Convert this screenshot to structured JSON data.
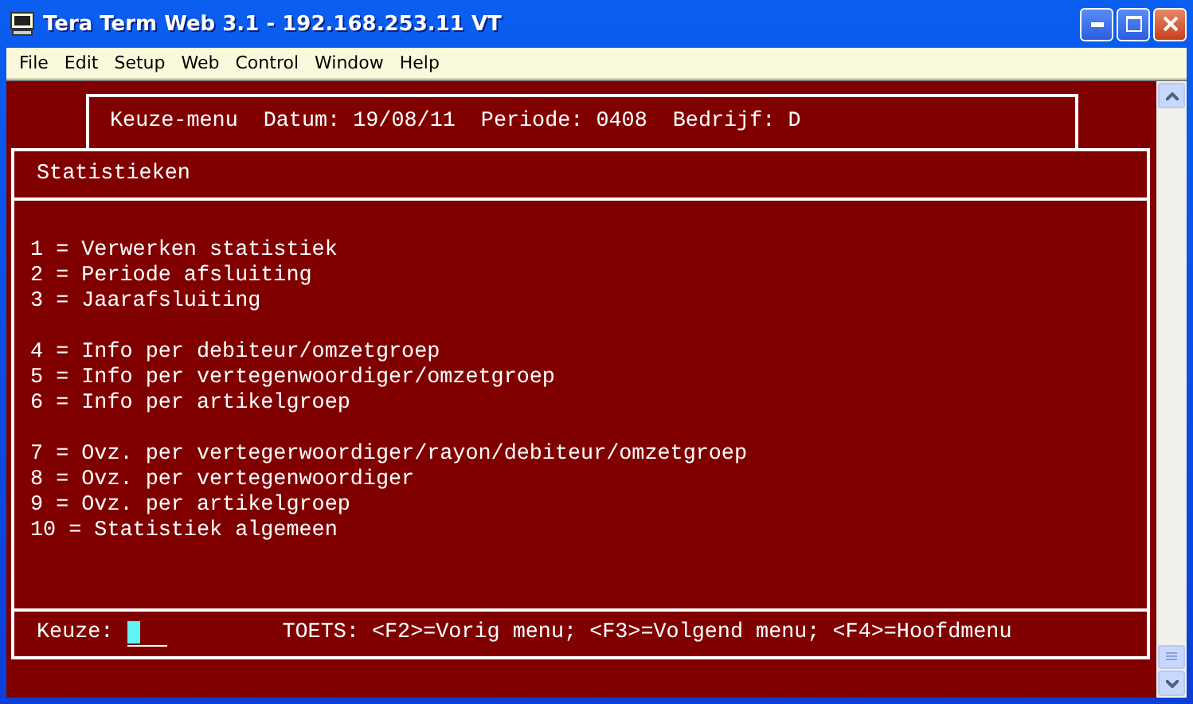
{
  "window": {
    "title": "Tera Term Web 3.1 - 192.168.253.11 VT"
  },
  "menu_bar": [
    {
      "label": "File"
    },
    {
      "label": "Edit"
    },
    {
      "label": "Setup"
    },
    {
      "label": "Web"
    },
    {
      "label": "Control"
    },
    {
      "label": "Window"
    },
    {
      "label": "Help"
    }
  ],
  "header": {
    "menu": "Keuze-menu",
    "date_label": "Datum:",
    "date": "19/08/11",
    "period_label": "Periode:",
    "period": "0408",
    "company_label": "Bedrijf:",
    "company": "D"
  },
  "panel": {
    "title": "Statistieken",
    "groups": [
      [
        "1 = Verwerken statistiek",
        "2 = Periode afsluiting",
        "3 = Jaarafsluiting"
      ],
      [
        "4 = Info per debiteur/omzetgroep",
        "5 = Info per vertegenwoordiger/omzetgroep",
        "6 = Info per artikelgroep"
      ],
      [
        "7 = Ovz. per vertegerwoordiger/rayon/debiteur/omzetgroep",
        "8 = Ovz. per vertegenwoordiger",
        "9 = Ovz. per artikelgroep",
        "10 = Statistiek algemeen"
      ]
    ]
  },
  "footer": {
    "prompt": "Keuze:",
    "keys": "TOETS: <F2>=Vorig menu; <F3>=Volgend menu; <F4>=Hoofdmenu"
  }
}
